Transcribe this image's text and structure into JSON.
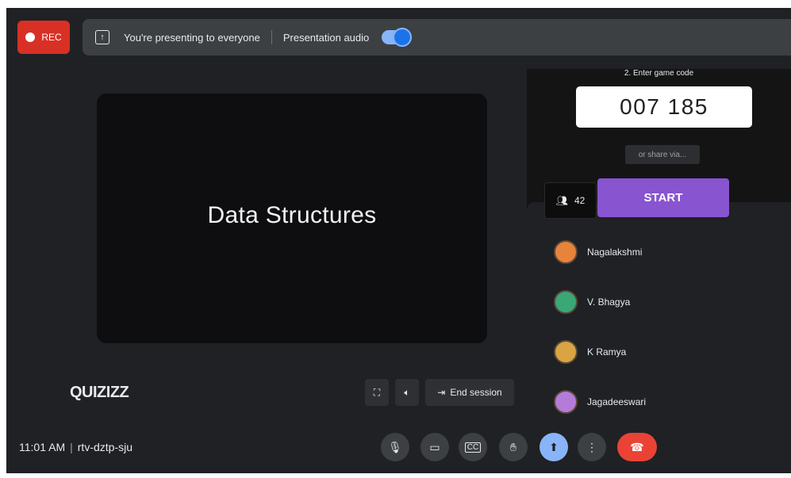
{
  "topbar": {
    "rec_label": "REC",
    "presenting_text": "You're presenting to everyone",
    "audio_label": "Presentation audio",
    "audio_enabled": true
  },
  "slide": {
    "title": "Data Structures"
  },
  "brand": {
    "logo_text": "QUIZIZZ"
  },
  "slide_controls": {
    "fullscreen_icon": "fullscreen-icon",
    "volume_icon": "volume-icon",
    "end_session_label": "End session"
  },
  "quiz_panel": {
    "enter_code_label": "2. Enter game code",
    "game_code": "007 185",
    "share_label": "or share via...",
    "participant_count": "42",
    "start_label": "START",
    "players": [
      {
        "name": "Nagalakshmi",
        "color": "#e8833a"
      },
      {
        "name": "V. Bhagya",
        "color": "#3aa876"
      },
      {
        "name": "K Ramya",
        "color": "#d9a441"
      },
      {
        "name": "Jagadeeswari",
        "color": "#b57bd8"
      }
    ]
  },
  "bottombar": {
    "time": "11:01 AM",
    "meeting_code": "rtv-dztp-sju"
  },
  "colors": {
    "rec": "#d93025",
    "start": "#8854d0",
    "present_active": "#8ab4f8",
    "hangup": "#ea4335"
  }
}
